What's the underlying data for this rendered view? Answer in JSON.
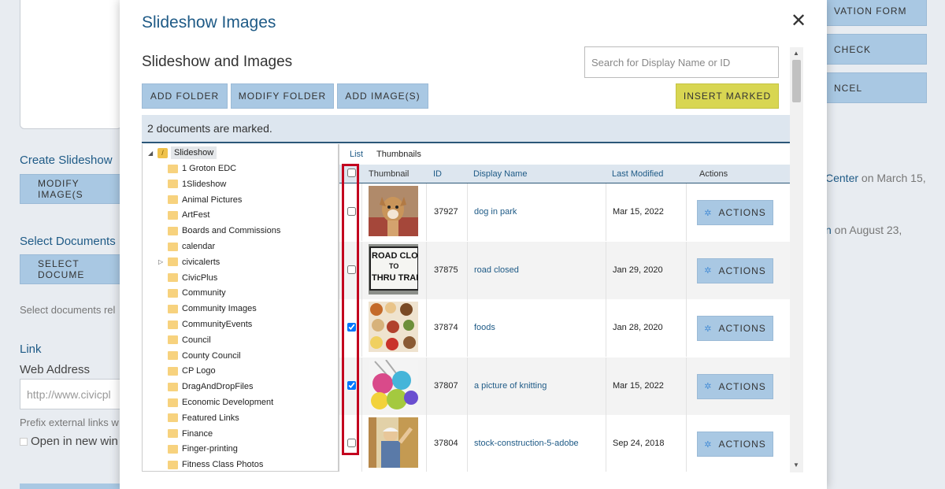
{
  "background": {
    "create_slideshow_heading": "Create Slideshow",
    "modify_images_button": "MODIFY IMAGE(S",
    "select_documents_heading": "Select Documents",
    "select_documents_button": "SELECT DOCUME",
    "select_documents_help": "Select documents rel",
    "link_heading": "Link",
    "web_address_label": "Web Address",
    "web_address_placeholder": "http://www.civicpl",
    "prefix_help": "Prefix external links w",
    "open_new_window_label": "Open in new win",
    "right_buttons": [
      "VATION FORM",
      "CHECK",
      "NCEL"
    ],
    "right_snippet_1_link": "Center",
    "right_snippet_1_rest": " on March 15,",
    "right_snippet_2_link": "n",
    "right_snippet_2_rest": " on August 23,"
  },
  "modal": {
    "title": "Slideshow Images",
    "subtitle": "Slideshow and Images",
    "search_placeholder": "Search for Display Name or ID",
    "toolbar": {
      "add_folder": "ADD FOLDER",
      "modify_folder": "MODIFY FOLDER",
      "add_images": "ADD IMAGE(S)",
      "insert_marked": "INSERT MARKED"
    },
    "marked_status": "2 documents are marked."
  },
  "tree": {
    "root": "Slideshow",
    "folders": [
      "1 Groton EDC",
      "1Slideshow",
      "Animal Pictures",
      "ArtFest",
      "Boards and Commissions",
      "calendar",
      "civicalerts",
      "CivicPlus",
      "Community",
      "Community Images",
      "CommunityEvents",
      "Council",
      "County Council",
      "CP Logo",
      "DragAndDropFiles",
      "Economic Development",
      "Featured Links",
      "Finance",
      "Finger-printing",
      "Fitness Class Photos"
    ]
  },
  "view_tabs": {
    "list": "List",
    "thumbnails": "Thumbnails"
  },
  "table": {
    "headers": {
      "thumbnail": "Thumbnail",
      "id": "ID",
      "display_name": "Display Name",
      "last_modified": "Last Modified",
      "actions": "Actions"
    },
    "action_label": "ACTIONS",
    "rows": [
      {
        "id": "37927",
        "name": "dog in park",
        "modified": "Mar 15, 2022",
        "checked": false,
        "thumb": "dog"
      },
      {
        "id": "37875",
        "name": "road closed",
        "modified": "Jan 29, 2020",
        "checked": false,
        "thumb": "road-sign"
      },
      {
        "id": "37874",
        "name": "foods",
        "modified": "Jan 28, 2020",
        "checked": true,
        "thumb": "foods"
      },
      {
        "id": "37807",
        "name": "a picture of knitting",
        "modified": "Mar 15, 2022",
        "checked": true,
        "thumb": "yarn"
      },
      {
        "id": "37804",
        "name": "stock-construction-5-adobe",
        "modified": "Sep 24, 2018",
        "checked": false,
        "thumb": "construction"
      }
    ],
    "road_sign_text": [
      "ROAD CLOS",
      "TO",
      "THRU TRAF"
    ]
  },
  "colors": {
    "accent": "#1e5a86",
    "button": "#a9c8e3",
    "insert_button": "#d8d652",
    "highlight": "#c3001f"
  }
}
